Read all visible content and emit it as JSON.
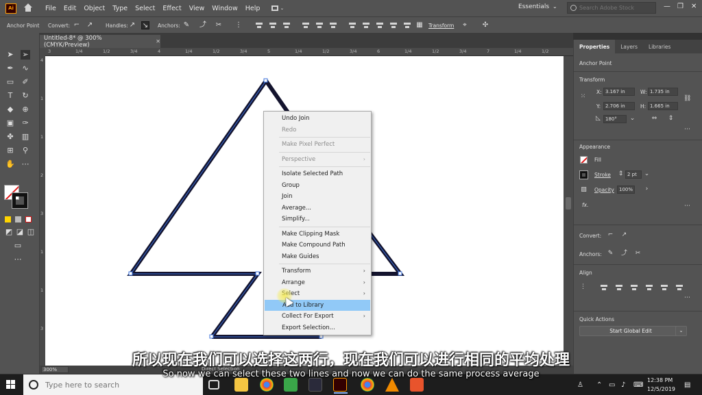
{
  "menubar": {
    "logo": "Ai",
    "items": [
      "File",
      "Edit",
      "Object",
      "Type",
      "Select",
      "Effect",
      "View",
      "Window",
      "Help"
    ],
    "workspace": "Essentials",
    "stock_search_placeholder": "Search Adobe Stock",
    "window_controls": [
      "—",
      "❐",
      "✕"
    ]
  },
  "controlbar": {
    "anchor_point": "Anchor Point",
    "convert": "Convert:",
    "handles": "Handles:",
    "anchors": "Anchors:",
    "transform": "Transform"
  },
  "document": {
    "tab_title": "Untitled-8* @ 300% (CMYK/Preview)",
    "close": "✕"
  },
  "ruler": {
    "top_ticks": [
      "3",
      "1/4",
      "1/2",
      "3/4",
      "4",
      "1/4",
      "1/2",
      "3/4",
      "5",
      "1/4",
      "1/2",
      "3/4",
      "6",
      "1/4",
      "1/2",
      "3/4",
      "7",
      "1/4",
      "1/2"
    ],
    "left_ticks": [
      "4",
      "1",
      "1",
      "2",
      "3",
      "1",
      "1",
      "3"
    ]
  },
  "context_menu": {
    "items": [
      {
        "label": "Undo Join",
        "disabled": false,
        "submenu": false
      },
      {
        "label": "Redo",
        "disabled": true,
        "submenu": false
      },
      {
        "sep": true
      },
      {
        "label": "Make Pixel Perfect",
        "disabled": true,
        "submenu": false
      },
      {
        "sep": true
      },
      {
        "label": "Perspective",
        "disabled": true,
        "submenu": true
      },
      {
        "sep": true
      },
      {
        "label": "Isolate Selected Path",
        "disabled": false,
        "submenu": false
      },
      {
        "label": "Group",
        "disabled": false,
        "submenu": false
      },
      {
        "label": "Join",
        "disabled": false,
        "submenu": false
      },
      {
        "label": "Average...",
        "disabled": false,
        "submenu": false
      },
      {
        "label": "Simplify...",
        "disabled": false,
        "submenu": false
      },
      {
        "sep": true
      },
      {
        "label": "Make Clipping Mask",
        "disabled": false,
        "submenu": false
      },
      {
        "label": "Make Compound Path",
        "disabled": false,
        "submenu": false
      },
      {
        "label": "Make Guides",
        "disabled": false,
        "submenu": false
      },
      {
        "sep": true
      },
      {
        "label": "Transform",
        "disabled": false,
        "submenu": true
      },
      {
        "label": "Arrange",
        "disabled": false,
        "submenu": true
      },
      {
        "label": "Select",
        "disabled": false,
        "submenu": true
      },
      {
        "label": "Add to Library",
        "disabled": false,
        "submenu": false,
        "highlighted": true
      },
      {
        "label": "Collect For Export",
        "disabled": false,
        "submenu": true
      },
      {
        "label": "Export Selection...",
        "disabled": false,
        "submenu": false
      }
    ],
    "submenu_arrow": "›"
  },
  "properties_panel": {
    "tabs": [
      "Properties",
      "Layers",
      "Libraries"
    ],
    "selection_type": "Anchor Point",
    "transform_title": "Transform",
    "x_label": "X:",
    "x_value": "3.167 in",
    "y_label": "Y:",
    "y_value": "2.706 in",
    "w_label": "W:",
    "w_value": "1.735 in",
    "h_label": "H:",
    "h_value": "1.665 in",
    "rotate_value": "180°",
    "appearance_title": "Appearance",
    "fill_label": "Fill",
    "stroke_label": "Stroke",
    "stroke_value": "2 pt",
    "opacity_label": "Opacity",
    "opacity_value": "100%",
    "fx_label": "fx.",
    "convert_label": "Convert:",
    "anchors_label": "Anchors:",
    "align_title": "Align",
    "quick_actions_title": "Quick Actions",
    "quick_action_button": "Start Global Edit"
  },
  "statusbar": {
    "zoom": "300%",
    "status": "Direct Selection"
  },
  "subtitles": {
    "chinese": "所以现在我们可以选择这两行，现在我们可以进行相同的平均处理",
    "english": "So now we can select these two lines and now we can do the same process average"
  },
  "taskbar": {
    "search_placeholder": "Type here to search",
    "time": "12:38 PM",
    "date": "12/5/2019",
    "tray_icons": [
      "person-icon",
      "chevron-up-icon",
      "network-icon",
      "volume-icon",
      "keyboard-icon"
    ]
  },
  "colors": {
    "accent_highlight": "#91c9f7",
    "path_stroke": "#14142e",
    "anchor_point": "#3a6fd8"
  }
}
